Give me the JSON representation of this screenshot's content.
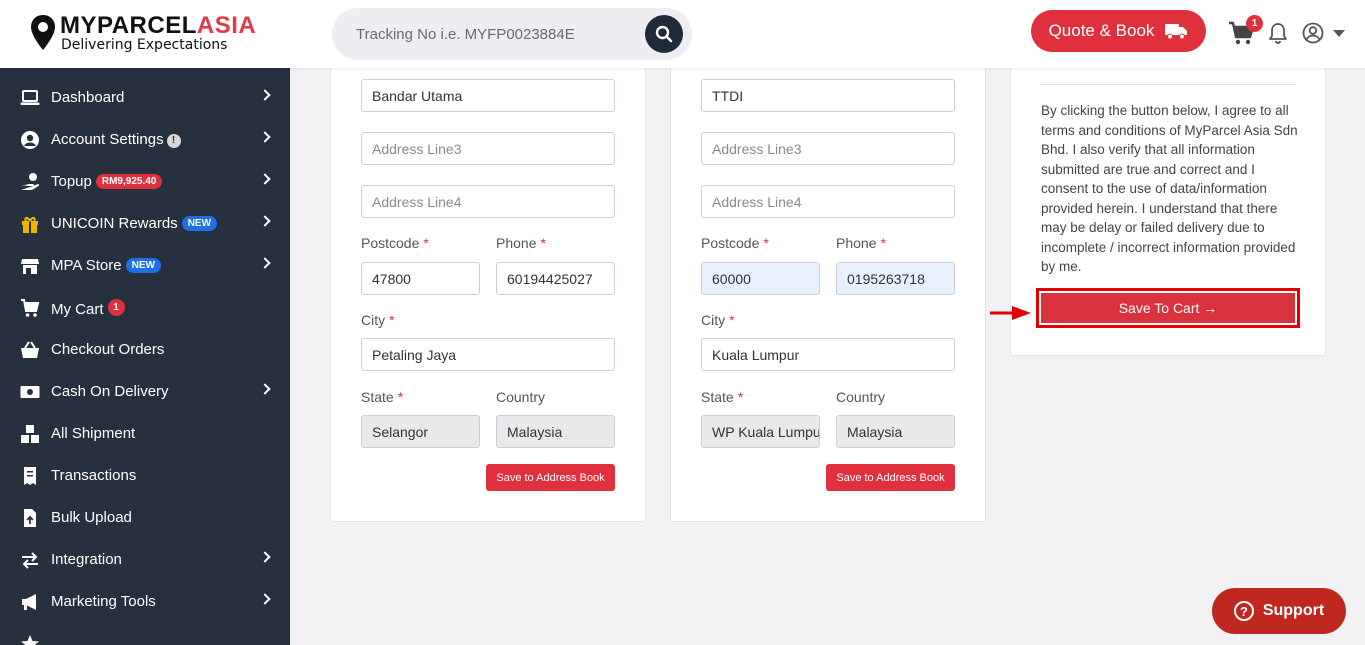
{
  "header": {
    "logo_main": "MYPARCEL",
    "logo_accent": "ASIA",
    "logo_tagline": "Delivering Expectations",
    "search_placeholder": "Tracking No i.e. MYFP0023884E",
    "quote_label": "Quote & Book",
    "cart_count": "1"
  },
  "sidebar": {
    "items": [
      {
        "label": "Dashboard",
        "icon": "laptop-icon",
        "chevron": true
      },
      {
        "label": "Account Settings",
        "icon": "user-circle-icon",
        "info": "!",
        "chevron": true
      },
      {
        "label": "Topup",
        "icon": "hand-coin-icon",
        "badge": "RM9,925.40",
        "chevron": true
      },
      {
        "label": "UNICOIN Rewards",
        "icon": "gift-icon",
        "badge": "NEW",
        "chevron": true
      },
      {
        "label": "MPA Store",
        "icon": "store-icon",
        "badge": "NEW",
        "chevron": true
      },
      {
        "label": "My Cart",
        "icon": "cart-plus-icon",
        "badge": "1",
        "chevron": false
      },
      {
        "label": "Checkout Orders",
        "icon": "basket-icon",
        "chevron": false
      },
      {
        "label": "Cash On Delivery",
        "icon": "money-icon",
        "chevron": true
      },
      {
        "label": "All Shipment",
        "icon": "boxes-icon",
        "chevron": false
      },
      {
        "label": "Transactions",
        "icon": "receipt-icon",
        "chevron": false
      },
      {
        "label": "Bulk Upload",
        "icon": "file-upload-icon",
        "chevron": false
      },
      {
        "label": "Integration",
        "icon": "exchange-icon",
        "chevron": true
      },
      {
        "label": "Marketing Tools",
        "icon": "megaphone-icon",
        "chevron": true
      }
    ]
  },
  "sender": {
    "address_line2": "Bandar Utama",
    "address_line3_placeholder": "Address Line3",
    "address_line4_placeholder": "Address Line4",
    "postcode_label": "Postcode",
    "phone_label": "Phone",
    "postcode": "47800",
    "phone": "60194425027",
    "city_label": "City",
    "city": "Petaling Jaya",
    "state_label": "State",
    "country_label": "Country",
    "state": "Selangor",
    "country": "Malaysia",
    "save_label": "Save to Address Book"
  },
  "receiver": {
    "address_line2": "TTDI",
    "address_line3_placeholder": "Address Line3",
    "address_line4_placeholder": "Address Line4",
    "postcode_label": "Postcode",
    "phone_label": "Phone",
    "postcode": "60000",
    "phone": "0195263718",
    "city_label": "City",
    "city": "Kuala Lumpur",
    "state_label": "State",
    "country_label": "Country",
    "state": "WP Kuala Lumpur",
    "country": "Malaysia",
    "save_label": "Save to Address Book"
  },
  "summary": {
    "terms": "By clicking the button below, I agree to all terms and conditions of MyParcel Asia Sdn Bhd. I also verify that all information submitted are true and correct and I consent to the use of data/information provided herein. I understand that there may be delay or failed delivery due to incomplete / incorrect information provided by me.",
    "save_to_cart": "Save To Cart →"
  },
  "support_label": "Support",
  "colors": {
    "brand_red": "#e0303e",
    "sidebar_bg": "#27303f",
    "annotation_red": "#e30000"
  }
}
